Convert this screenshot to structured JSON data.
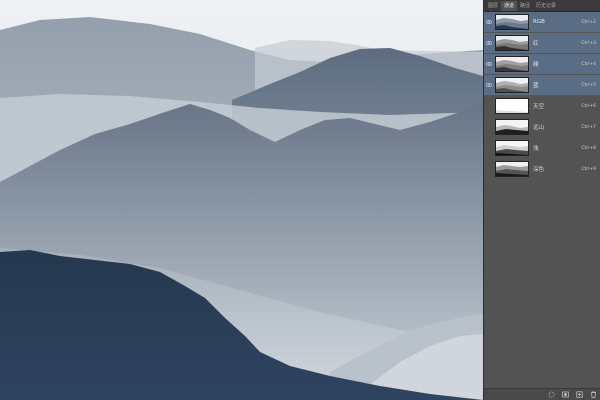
{
  "colors": {
    "panel_bg": "#535353",
    "selected_row": "#5b6d84",
    "sky": "#e9edf0",
    "deep_mountain": "#24374f"
  },
  "panel": {
    "tabs": [
      {
        "label": "图层",
        "active": false
      },
      {
        "label": "通道",
        "active": true
      },
      {
        "label": "路径",
        "active": false
      },
      {
        "label": "历史记录",
        "active": false
      }
    ],
    "channels": [
      {
        "name": "RGB",
        "shortcut": "Ctrl+2",
        "selected": true,
        "visible": true,
        "thumb": "color"
      },
      {
        "name": "红",
        "shortcut": "Ctrl+3",
        "selected": true,
        "visible": true,
        "thumb": "gray"
      },
      {
        "name": "绿",
        "shortcut": "Ctrl+4",
        "selected": true,
        "visible": true,
        "thumb": "gray"
      },
      {
        "name": "蓝",
        "shortcut": "Ctrl+5",
        "selected": true,
        "visible": true,
        "thumb": "gray"
      },
      {
        "name": "天空",
        "shortcut": "Ctrl+6",
        "selected": false,
        "visible": false,
        "thumb": "white"
      },
      {
        "name": "远山",
        "shortcut": "Ctrl+7",
        "selected": false,
        "visible": false,
        "thumb": "mask-far"
      },
      {
        "name": "浅",
        "shortcut": "Ctrl+8",
        "selected": false,
        "visible": false,
        "thumb": "mask-light"
      },
      {
        "name": "深色",
        "shortcut": "Ctrl+9",
        "selected": false,
        "visible": false,
        "thumb": "mask-dark"
      }
    ],
    "bottom_icons": [
      "dotted-circle-icon",
      "mask-icon",
      "new-channel-icon",
      "trash-icon"
    ]
  }
}
